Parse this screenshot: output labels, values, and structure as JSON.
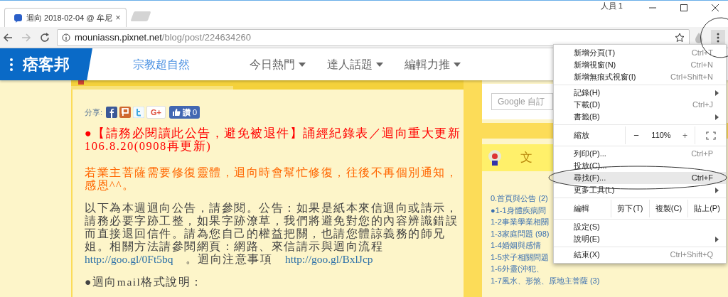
{
  "browser": {
    "tab": {
      "title": "迴向 2018-02-04 @ 牟尼",
      "close": "×"
    },
    "profile": "人員 1",
    "url": {
      "host": "mouniassn.pixnet.net",
      "path": "/blog/post/224634260"
    },
    "menu_button": {
      "circled": true
    }
  },
  "site_header": {
    "logo": "痞客邦",
    "nav": [
      {
        "label": "宗教超自然",
        "kind": "category"
      },
      {
        "label": "今日熱門",
        "kind": "dropdown"
      },
      {
        "label": "達人話題",
        "kind": "dropdown"
      },
      {
        "label": "編輯力推",
        "kind": "dropdown"
      }
    ]
  },
  "post": {
    "share_label": "分享:",
    "share_buttons": [
      {
        "kind": "facebook"
      },
      {
        "kind": "plurk"
      },
      {
        "kind": "twitter"
      },
      {
        "kind": "gplus",
        "label": "G+"
      },
      {
        "kind": "like",
        "label": "讚",
        "count": "0"
      }
    ],
    "paragraphs": [
      {
        "kind": "notice",
        "segments": [
          {
            "text": "●【請務必閱讀此公告，避免被退件】誦經紀錄表／迴向重大更新106.8.20(0908再更新)"
          }
        ]
      },
      {
        "kind": "highlight",
        "segments": [
          {
            "text": "若業主菩薩需要修復靈體，迴向時會幫忙修復，往後不再個別通知，感恩^^。"
          }
        ]
      },
      {
        "kind": "body",
        "segments": [
          {
            "text": "以下為本週迴向公告，請參閱。公告：如果是紙本來信迴向或請示，請務必要字跡工整，如果字跡潦草，我們將避免對您的內容辨識錯誤而直接退回信件。請為您自己的權益把關，也請您體諒義務的師兄姐。相關方法請參閱網頁：網路、來信請示與迴向流程 "
          },
          {
            "link": "http://goo.gl/0Ft5bq"
          },
          {
            "text": "　。迴向注意事項　"
          },
          {
            "link": "http://goo.gl/BxlJcp"
          }
        ]
      },
      {
        "kind": "body",
        "segments": [
          {
            "text": "●迴向mail格式說明："
          }
        ]
      }
    ]
  },
  "sidebar": {
    "search": {
      "placeholder": "Google 自訂"
    },
    "widget_title": "文",
    "categories": [
      {
        "label": "0.首頁與公告 (2)"
      },
      {
        "label": "●1-1身體疾病問"
      },
      {
        "label": "1-2事業學業相關"
      },
      {
        "label": "1-3家庭問題 (98)"
      },
      {
        "label": "1-4婚姻與感情"
      },
      {
        "label": "1-5求子相關問題"
      },
      {
        "label": "1-6外靈(沖犯、"
      },
      {
        "label": "1-7風水、形煞、原地主菩薩 (3)"
      }
    ]
  },
  "chrome_menu": {
    "items": [
      {
        "kind": "item",
        "label": "新增分頁(T)",
        "shortcut": "Ctrl+T",
        "selected": false
      },
      {
        "kind": "item",
        "label": "新增視窗(N)",
        "shortcut": "Ctrl+N",
        "selected": false
      },
      {
        "kind": "item",
        "label": "新增無痕式視窗(I)",
        "shortcut": "Ctrl+Shift+N",
        "selected": false
      },
      {
        "kind": "separator"
      },
      {
        "kind": "submenu",
        "label": "記錄(H)",
        "selected": false
      },
      {
        "kind": "item",
        "label": "下載(D)",
        "shortcut": "Ctrl+J",
        "selected": false
      },
      {
        "kind": "submenu",
        "label": "書籤(B)",
        "selected": false
      },
      {
        "kind": "separator"
      },
      {
        "kind": "zoom",
        "label": "縮放",
        "minus": "−",
        "value": "110%",
        "plus": "+"
      },
      {
        "kind": "separator"
      },
      {
        "kind": "item",
        "label": "列印(P)...",
        "shortcut": "Ctrl+P",
        "selected": false
      },
      {
        "kind": "item",
        "label": "投放(C)...",
        "selected": false
      },
      {
        "kind": "item",
        "label": "尋找(F)...",
        "shortcut": "Ctrl+F",
        "selected": true,
        "circled": true
      },
      {
        "kind": "submenu",
        "label": "更多工具(L)",
        "selected": false
      },
      {
        "kind": "separator"
      },
      {
        "kind": "edit",
        "label": "編輯",
        "actions": [
          "剪下(T)",
          "複製(C)",
          "貼上(P)"
        ]
      },
      {
        "kind": "separator"
      },
      {
        "kind": "item",
        "label": "設定(S)",
        "selected": false
      },
      {
        "kind": "submenu",
        "label": "說明(E)",
        "selected": false
      },
      {
        "kind": "separator"
      },
      {
        "kind": "item",
        "label": "結束(X)",
        "shortcut": "Ctrl+Shift+Q",
        "selected": false
      }
    ]
  }
}
